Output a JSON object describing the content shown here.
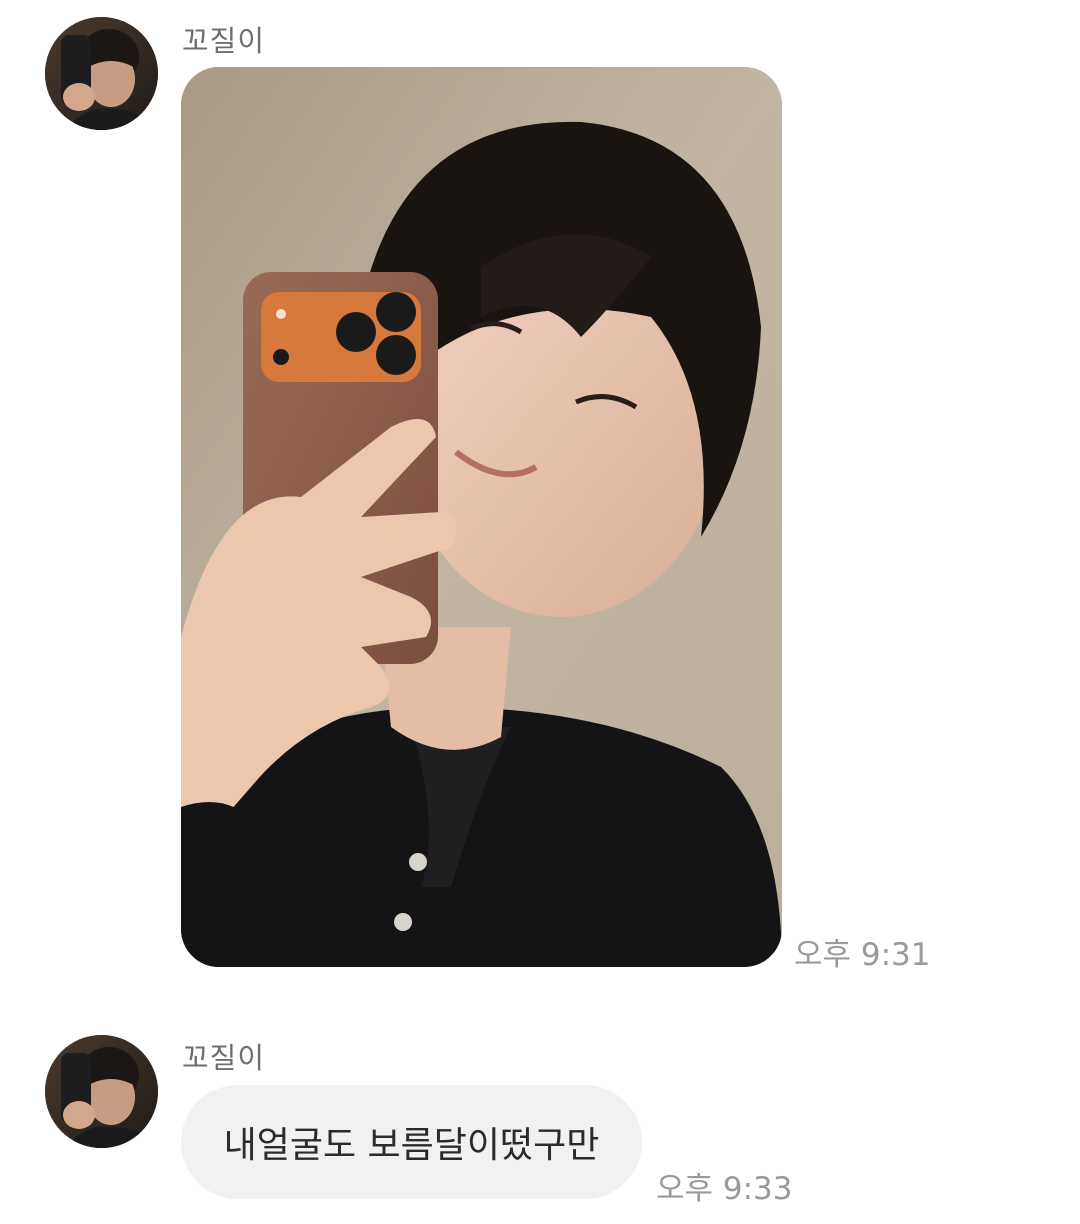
{
  "messages": [
    {
      "sender": "꼬질이",
      "avatar_icon": "profile-photo",
      "type": "photo",
      "photo_icon": "selfie-photo",
      "time": "오후 9:31"
    },
    {
      "sender": "꼬질이",
      "avatar_icon": "profile-photo",
      "type": "text",
      "text": "내얼굴도 보름달이떴구만",
      "time": "오후 9:33"
    }
  ],
  "colors": {
    "background": "#ffffff",
    "bubble": "#f1f1f4",
    "name_text": "#6f6f6f",
    "time_text": "#9a9a9a"
  }
}
